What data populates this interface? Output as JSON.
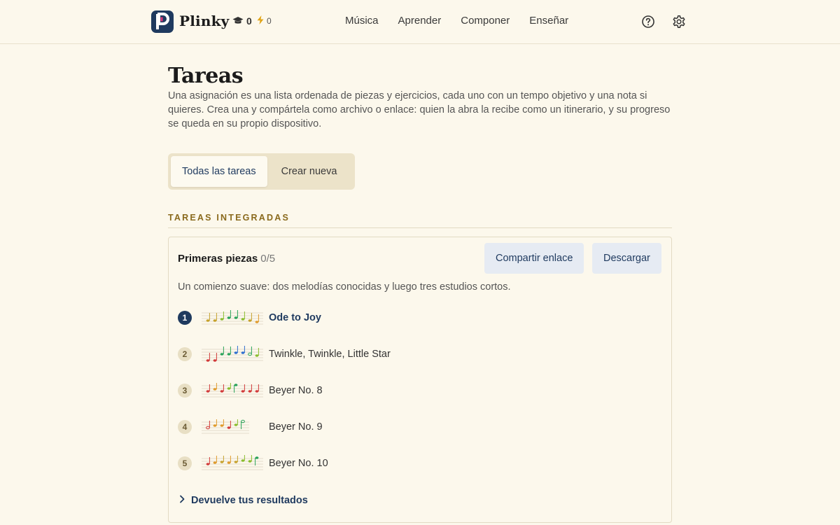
{
  "app": {
    "brand": "Plinky",
    "logo_letter": "P",
    "courses_count": "0",
    "streak_count": "0"
  },
  "nav": {
    "items": [
      "Música",
      "Aprender",
      "Componer",
      "Enseñar"
    ]
  },
  "icons": {
    "courses": "graduation-cap-icon",
    "streak": "lightning-icon",
    "help": "help-circle-icon",
    "settings": "gear-icon",
    "expand": "chevron-right-icon"
  },
  "colors": {
    "accent": "#1f3a5f",
    "background": "#fcf8ec",
    "section_label": "#8a6a1d"
  },
  "page": {
    "title": "Tareas",
    "description": "Una asignación es una lista ordenada de piezas y ejercicios, cada uno con un tempo objetivo y una nota si quieres. Crea una y compártela como archivo o enlace: quien la abra la recibe como un itinerario, y su progreso se queda en su propio dispositivo."
  },
  "tabs": {
    "all": "Todas las tareas",
    "create": "Crear nueva",
    "active": "all"
  },
  "section": {
    "label": "TAREAS INTEGRADAS"
  },
  "assignment": {
    "title": "Primeras piezas",
    "progress": "0/5",
    "share_label": "Compartir enlace",
    "download_label": "Descargar",
    "description": "Un comienzo suave: dos melodías conocidas y luego tres estudios cortos.",
    "pieces": [
      {
        "number": "1",
        "name": "Ode to Joy",
        "current": true
      },
      {
        "number": "2",
        "name": "Twinkle, Twinkle, Little Star",
        "current": false
      },
      {
        "number": "3",
        "name": "Beyer No. 8",
        "current": false
      },
      {
        "number": "4",
        "name": "Beyer No. 9",
        "current": false
      },
      {
        "number": "5",
        "name": "Beyer No. 10",
        "current": false
      }
    ],
    "results_label": "Devuelve tus resultados"
  }
}
